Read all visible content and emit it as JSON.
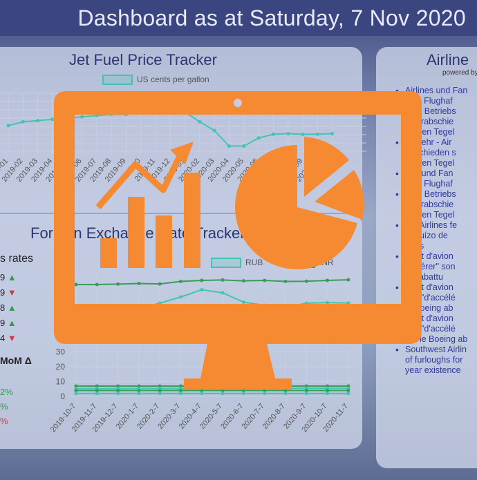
{
  "header": {
    "title": "Dashboard as at Saturday, 7 Nov 2020"
  },
  "jet_fuel": {
    "title": "Jet Fuel Price Tracker",
    "legend": "US cents per gallon",
    "x_labels": [
      "2019-01",
      "2019-02",
      "2019-03",
      "2019-04",
      "2019-05",
      "2019-06",
      "2019-07",
      "2019-08",
      "2019-09",
      "2019-10",
      "2019-11",
      "2019-12",
      "2020-01",
      "2020-02",
      "2020-03",
      "2020-04",
      "2020-05",
      "2020-06",
      "2020-07",
      "2020-08",
      "2020-09",
      "2020-10",
      "2020-11"
    ],
    "series_color": "#43c4b3"
  },
  "fx": {
    "title": "Foreign Exchange Rate Tracker",
    "rates_label": "s rates",
    "rates": [
      {
        "value": "9",
        "arrow": "▲",
        "dir": "up"
      },
      {
        "value": "9",
        "arrow": "▼",
        "dir": "dn"
      },
      {
        "value": "8",
        "arrow": "▲",
        "dir": "up"
      },
      {
        "value": "9",
        "arrow": "▲",
        "dir": "up"
      },
      {
        "value": "4",
        "arrow": "▼",
        "dir": "dn"
      }
    ],
    "mom_label": "MoM Δ",
    "mom": [
      {
        "value": "2%",
        "dir": "up"
      },
      {
        "value": "%",
        "dir": "up"
      },
      {
        "value": "%",
        "dir": "dn"
      }
    ],
    "legend": [
      "RUB",
      "INR"
    ],
    "y_ticks": [
      "30",
      "20",
      "10",
      "0"
    ],
    "x_labels": [
      "2019-10-7",
      "2019-11-7",
      "2019-12-7",
      "2020-1-7",
      "2020-2-7",
      "2020-3-7",
      "2020-4-7",
      "2020-5-7",
      "2020-6-7",
      "2020-7-7",
      "2020-8-7",
      "2020-9-7",
      "2020-10-7",
      "2020-11-7"
    ]
  },
  "airline": {
    "title": "Airline",
    "powered": "powered by",
    "news": [
      {
        "text": "Airlines und Fan",
        "bullet": true
      },
      {
        "text": "vom Flughaf",
        "bullet": false
      },
      {
        "text": "tzter Betriebs",
        "bullet": false
      },
      {
        "text": "s verabschie",
        "bullet": false
      },
      {
        "text": "ghafen Tegel",
        "bullet": false
      },
      {
        "text": "verkehr - Air",
        "bullet": true
      },
      {
        "text": "abschieden s",
        "bullet": false
      },
      {
        "text": "ghafen Tegel",
        "bullet": false
      },
      {
        "text": "nes und Fan",
        "bullet": true
      },
      {
        "text": "vom Flughaf",
        "bullet": false
      },
      {
        "text": "tzter Betriebs",
        "bullet": true
      },
      {
        "text": "s verabschie",
        "bullet": false
      },
      {
        "text": "ghafen Tegel",
        "bullet": false
      },
      {
        "text": "am Airlines fe",
        "bullet": true
      },
      {
        "text": "prejuízo de",
        "bullet": false
      },
      {
        "text": "hões",
        "bullet": false
      },
      {
        "text": "ident d'avion",
        "bullet": true
      },
      {
        "text": "ccélérer\" son",
        "bullet": false
      },
      {
        "text": "ing abattu",
        "bullet": false
      },
      {
        "text": "ident d'avion",
        "bullet": true
      },
      {
        "text": "ssé \"d'accélé",
        "bullet": false
      },
      {
        "text": "le Boeing ab",
        "bullet": false
      },
      {
        "text": "ident d'avion",
        "bullet": false
      },
      {
        "text": "ssé \"d'accélé",
        "bullet": false
      },
      {
        "text": "sur le Boeing ab",
        "bullet": false
      },
      {
        "text": "Southwest Airlin",
        "bullet": true
      },
      {
        "text": "of furloughs for",
        "bullet": false
      },
      {
        "text": "year existence",
        "bullet": false
      }
    ]
  },
  "overlay": {
    "icon": "computer-analytics-icon",
    "color": "#f58a32"
  }
}
